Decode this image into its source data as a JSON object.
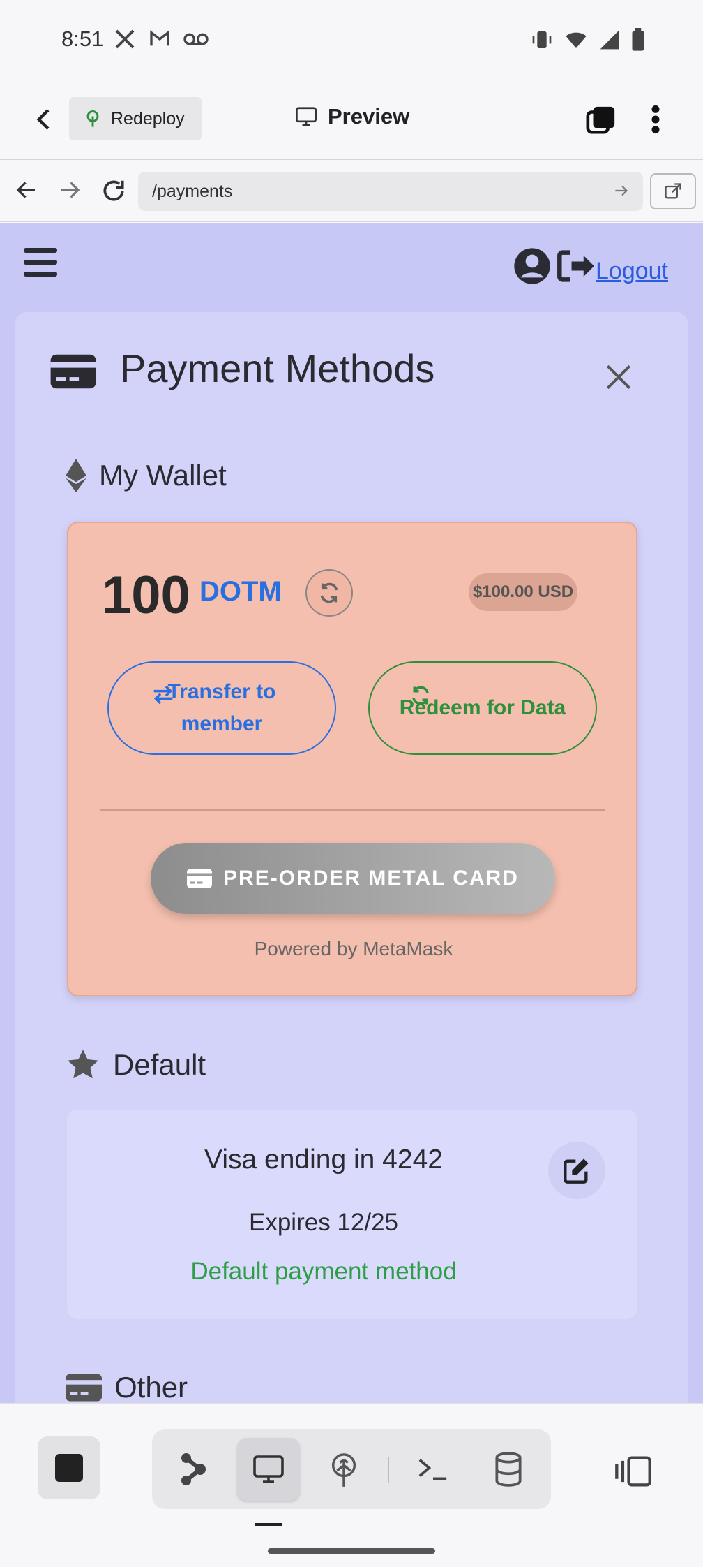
{
  "status_bar": {
    "time": "8:51",
    "left_icons": [
      "x-logo-icon",
      "gmail-icon",
      "voicemail-icon"
    ],
    "right_icons": [
      "vibrate-icon",
      "wifi-icon",
      "signal-icon",
      "battery-icon"
    ]
  },
  "app_bar": {
    "redeploy_label": "Redeploy",
    "preview_label": "Preview"
  },
  "browser": {
    "url": "/payments"
  },
  "page_header": {
    "logout_label": "Logout"
  },
  "payment_methods": {
    "title": "Payment Methods",
    "wallet": {
      "heading": "My Wallet",
      "amount": "100",
      "currency": "DOTM",
      "usd_value": "$100.00 USD",
      "transfer_label": "Transfer to member",
      "redeem_label": "Redeem for Data",
      "preorder_label": "PRE-ORDER METAL CARD",
      "powered_by": "Powered by MetaMask"
    },
    "default": {
      "heading": "Default",
      "card_label": "Visa ending in 4242",
      "expires": "Expires 12/25",
      "status": "Default payment method"
    },
    "other": {
      "heading": "Other"
    }
  },
  "colors": {
    "page_bg": "#c8c8f7",
    "wallet_bg": "#f4bfae",
    "accent_blue": "#2a6fe0",
    "accent_green": "#2e8f3c"
  }
}
